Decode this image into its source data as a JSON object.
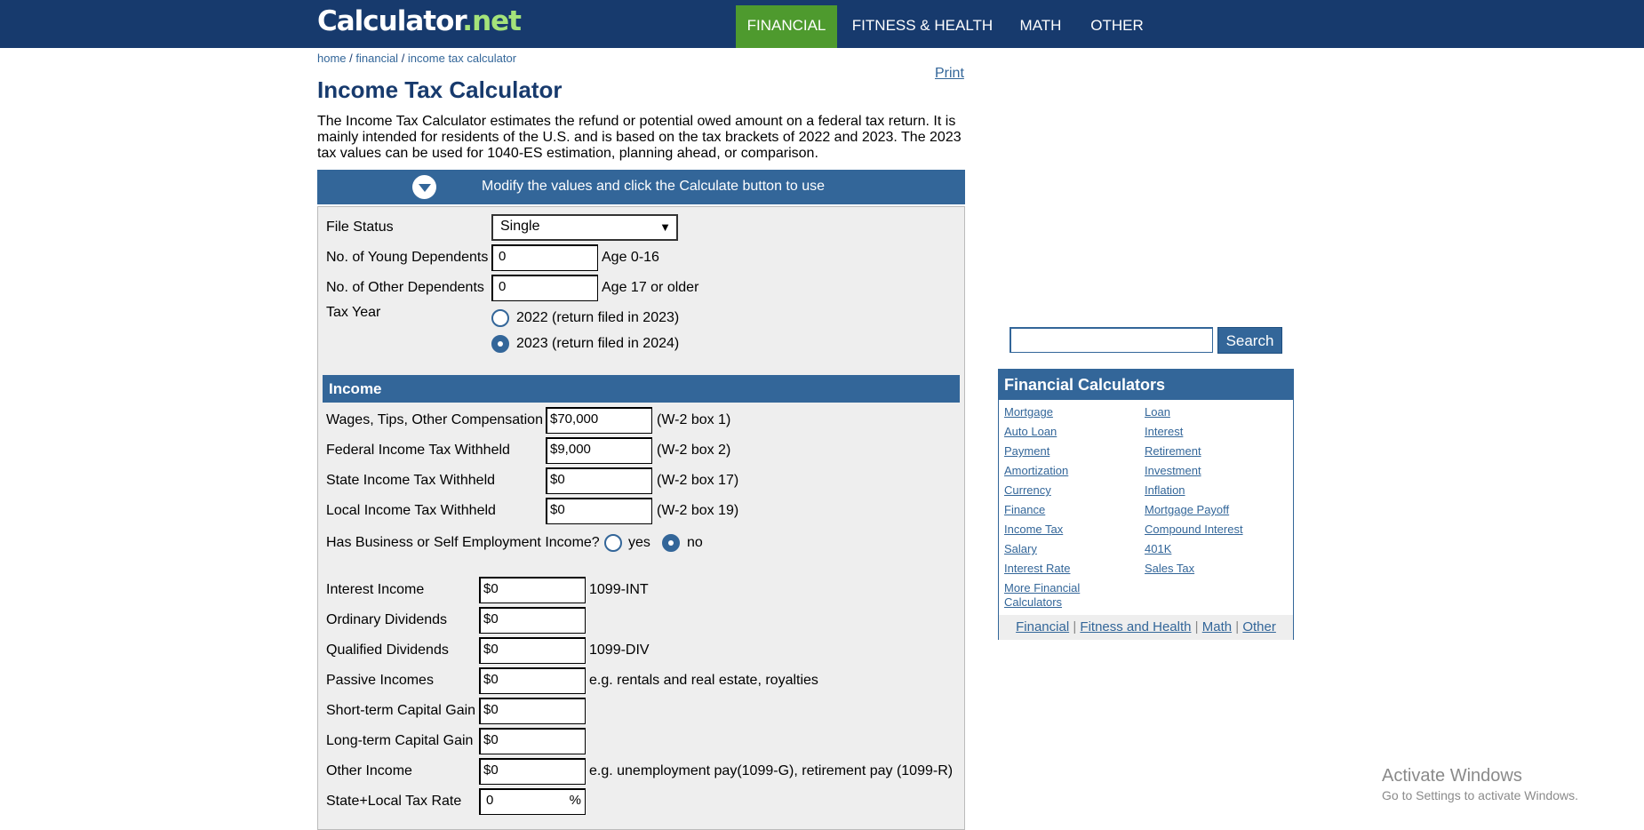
{
  "header": {
    "logo_main": "Calculator",
    "logo_dot": ".",
    "logo_tld": "net",
    "nav": [
      "FINANCIAL",
      "FITNESS & HEALTH",
      "MATH",
      "OTHER"
    ],
    "active_nav": "FINANCIAL"
  },
  "breadcrumb": {
    "items": [
      "home",
      "financial",
      "income tax calculator"
    ],
    "separator": " / "
  },
  "print_label": "Print",
  "title": "Income Tax Calculator",
  "intro": "The Income Tax Calculator estimates the refund or potential owed amount on a federal tax return. It is mainly intended for residents of the U.S. and is based on the tax brackets of 2022 and 2023. The 2023 tax values can be used for 1040-ES estimation, planning ahead, or comparison.",
  "modify_bar": {
    "text": "Modify the values and click the Calculate button to use",
    "icon": "chevron-down-circle-icon"
  },
  "form": {
    "file_status": {
      "label": "File Status",
      "value": "Single"
    },
    "young_dependents": {
      "label": "No. of Young Dependents",
      "value": "0",
      "hint": "Age 0-16"
    },
    "other_dependents": {
      "label": "No. of Other Dependents",
      "value": "0",
      "hint": "Age 17 or older"
    },
    "tax_year": {
      "label": "Tax Year",
      "options": [
        "2022 (return filed in 2023)",
        "2023 (return filed in 2024)"
      ],
      "selected": "2023 (return filed in 2024)"
    },
    "income_header": "Income",
    "wages": {
      "label": "Wages, Tips, Other Compensation",
      "value": "$70,000",
      "hint": "(W-2 box 1)"
    },
    "fed_withheld": {
      "label": "Federal Income Tax Withheld",
      "value": "$9,000",
      "hint": "(W-2 box 2)"
    },
    "state_withheld": {
      "label": "State Income Tax Withheld",
      "value": "$0",
      "hint": "(W-2 box 17)"
    },
    "local_withheld": {
      "label": "Local Income Tax Withheld",
      "value": "$0",
      "hint": "(W-2 box 19)"
    },
    "business_income": {
      "label": "Has Business or Self Employment Income?",
      "yes": "yes",
      "no": "no",
      "selected": "no"
    },
    "interest": {
      "label": "Interest Income",
      "value": "$0",
      "hint": "1099-INT"
    },
    "ordinary_div": {
      "label": "Ordinary Dividends",
      "value": "$0",
      "hint": ""
    },
    "qualified_div": {
      "label": "Qualified Dividends",
      "value": "$0",
      "hint": "1099-DIV"
    },
    "passive": {
      "label": "Passive Incomes",
      "value": "$0",
      "hint": "e.g. rentals and real estate, royalties"
    },
    "short_term": {
      "label": "Short-term Capital Gain",
      "value": "$0",
      "hint": ""
    },
    "long_term": {
      "label": "Long-term Capital Gain",
      "value": "$0",
      "hint": ""
    },
    "other_income": {
      "label": "Other Income",
      "value": "$0",
      "hint": "e.g. unemployment pay(1099-G), retirement pay (1099-R)"
    },
    "state_local_rate": {
      "label": "State+Local Tax Rate",
      "value": "0",
      "unit": "%"
    }
  },
  "search": {
    "placeholder": "",
    "button": "Search"
  },
  "financial_box": {
    "title": "Financial Calculators",
    "left": [
      "Mortgage",
      "Auto Loan",
      "Payment",
      "Amortization",
      "Currency",
      "Finance",
      "Income Tax",
      "Salary",
      "Interest Rate",
      "More Financial Calculators"
    ],
    "right": [
      "Loan",
      "Interest",
      "Retirement",
      "Investment",
      "Inflation",
      "Mortgage Payoff",
      "Compound Interest",
      "401K",
      "Sales Tax"
    ],
    "footer": [
      "Financial",
      "Fitness and Health",
      "Math",
      "Other"
    ],
    "footer_sep": "|"
  },
  "windows_watermark": {
    "title": "Activate Windows",
    "sub": "Go to Settings to activate Windows."
  }
}
